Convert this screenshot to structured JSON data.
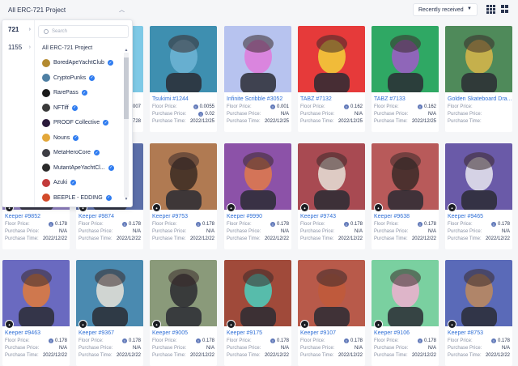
{
  "header": {
    "project_select": "All ERC-721 Project",
    "sort_select": "Recently received"
  },
  "dropdown": {
    "ids": [
      "721",
      "1155"
    ],
    "search_placeholder": "Search",
    "header_item": "All ERC-721 Project",
    "items": [
      {
        "label": "BoredApeYachtClub",
        "color": "#b38a2f"
      },
      {
        "label": "CryptoPunks",
        "color": "#4e7fa3"
      },
      {
        "label": "RarePass",
        "color": "#1a1a1a"
      },
      {
        "label": "NFTiff",
        "color": "#3a3a3a"
      },
      {
        "label": "PROOF Collective",
        "color": "#2a1a3a"
      },
      {
        "label": "Nouns",
        "color": "#e3a73a"
      },
      {
        "label": "MetaHeroCore",
        "color": "#3d3d44"
      },
      {
        "label": "MutantApeYachtCl...",
        "color": "#2a2a2a"
      },
      {
        "label": "Azuki",
        "color": "#c23a3a"
      },
      {
        "label": "BEEPLE - EDDING",
        "color": "#d24a2a"
      }
    ]
  },
  "labels": {
    "floor": "Floor Price:",
    "purchase": "Purchase Price:",
    "time": "Purchase Time:"
  },
  "cards": [
    {
      "name": "",
      "floor": "007",
      "purchase": "",
      "time": "728",
      "bg": "#7ec9e6",
      "fg": "#c9a0d0"
    },
    {
      "name": "Tsukimi #1244",
      "floor": "0.0055",
      "purchase": "0.02",
      "time": "2022/12/25",
      "bg": "#3e8fb0",
      "fg": "#6fb5d6"
    },
    {
      "name": "Infinite Scribble #3052",
      "floor": "0.001",
      "purchase": "N/A",
      "time": "2022/12/25",
      "bg": "#b7c3ef",
      "fg": "#e07adb"
    },
    {
      "name": "TABZ #7132",
      "floor": "0.162",
      "purchase": "N/A",
      "time": "2022/12/25",
      "bg": "#e63a3a",
      "fg": "#f2d23a"
    },
    {
      "name": "TABZ #7133",
      "floor": "0.162",
      "purchase": "N/A",
      "time": "2022/12/25",
      "bg": "#2fa864",
      "fg": "#a05ac8"
    },
    {
      "name": "Golden Skateboard Dra...",
      "floor": "",
      "purchase": "",
      "time": "",
      "bg": "#4f8a5a",
      "fg": "#d9b64a"
    },
    {
      "name": "Keeper #9852",
      "floor": "0.178",
      "purchase": "N/A",
      "time": "2022/12/22",
      "bg": "#8e7ec0",
      "fg": "#e09a5a"
    },
    {
      "name": "Keeper #9874",
      "floor": "0.178",
      "purchase": "N/A",
      "time": "2022/12/22",
      "bg": "#5b6ea8",
      "fg": "#e8d9a0"
    },
    {
      "name": "Keeper #9753",
      "floor": "0.178",
      "purchase": "N/A",
      "time": "2022/12/22",
      "bg": "#b07a52",
      "fg": "#3a2a22"
    },
    {
      "name": "Keeper #9990",
      "floor": "0.178",
      "purchase": "N/A",
      "time": "2022/12/22",
      "bg": "#8c52a8",
      "fg": "#e07a4a"
    },
    {
      "name": "Keeper #9743",
      "floor": "0.178",
      "purchase": "N/A",
      "time": "2022/12/22",
      "bg": "#a84a52",
      "fg": "#e8e2d8"
    },
    {
      "name": "Keeper #9638",
      "floor": "0.178",
      "purchase": "N/A",
      "time": "2022/12/22",
      "bg": "#b85a5a",
      "fg": "#3a2a28"
    },
    {
      "name": "Keeper #9465",
      "floor": "0.178",
      "purchase": "N/A",
      "time": "2022/12/22",
      "bg": "#6a5aa8",
      "fg": "#e8e8f0"
    },
    {
      "name": "Keeper #9463",
      "floor": "0.178",
      "purchase": "N/A",
      "time": "2022/12/22",
      "bg": "#6a6ac0",
      "fg": "#e07a3a"
    },
    {
      "name": "Keeper #9367",
      "floor": "0.178",
      "purchase": "N/A",
      "time": "2022/12/22",
      "bg": "#4a8ab0",
      "fg": "#e8e2d8"
    },
    {
      "name": "Keeper #9005",
      "floor": "0.178",
      "purchase": "N/A",
      "time": "2022/12/22",
      "bg": "#8a9a7a",
      "fg": "#2a2a30"
    },
    {
      "name": "Keeper #9175",
      "floor": "0.178",
      "purchase": "N/A",
      "time": "2022/12/22",
      "bg": "#a04a3a",
      "fg": "#4ad0c0"
    },
    {
      "name": "Keeper #9107",
      "floor": "0.178",
      "purchase": "N/A",
      "time": "2022/12/22",
      "bg": "#b85a4a",
      "fg": "#c05a3a"
    },
    {
      "name": "Keeper #9106",
      "floor": "0.178",
      "purchase": "N/A",
      "time": "2022/12/22",
      "bg": "#7ad0a0",
      "fg": "#f0b0d0"
    },
    {
      "name": "Keeper #8753",
      "floor": "0.178",
      "purchase": "N/A",
      "time": "2022/12/22",
      "bg": "#5a6ab8",
      "fg": "#c08a5a"
    }
  ]
}
